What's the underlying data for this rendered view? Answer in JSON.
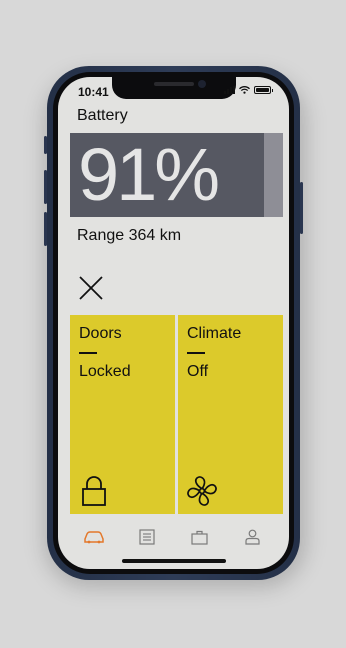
{
  "status_bar": {
    "time": "10:41"
  },
  "battery": {
    "title": "Battery",
    "percent_label": "91%",
    "percent_value": 91,
    "range_label": "Range 364 km"
  },
  "tiles": {
    "doors": {
      "title": "Doors",
      "value": "Locked",
      "icon": "lock-icon"
    },
    "climate": {
      "title": "Climate",
      "value": "Off",
      "icon": "fan-icon"
    }
  },
  "tabs": [
    {
      "icon": "car-icon",
      "active": true
    },
    {
      "icon": "list-icon",
      "active": false
    },
    {
      "icon": "briefcase-icon",
      "active": false
    },
    {
      "icon": "user-icon",
      "active": false
    }
  ],
  "colors": {
    "tile_yellow": "#dcca2b",
    "battery_fill": "#565862",
    "battery_track": "#8e8e96",
    "accent_active_tab": "#e3782b",
    "phone_frame": "#2e3c57"
  }
}
